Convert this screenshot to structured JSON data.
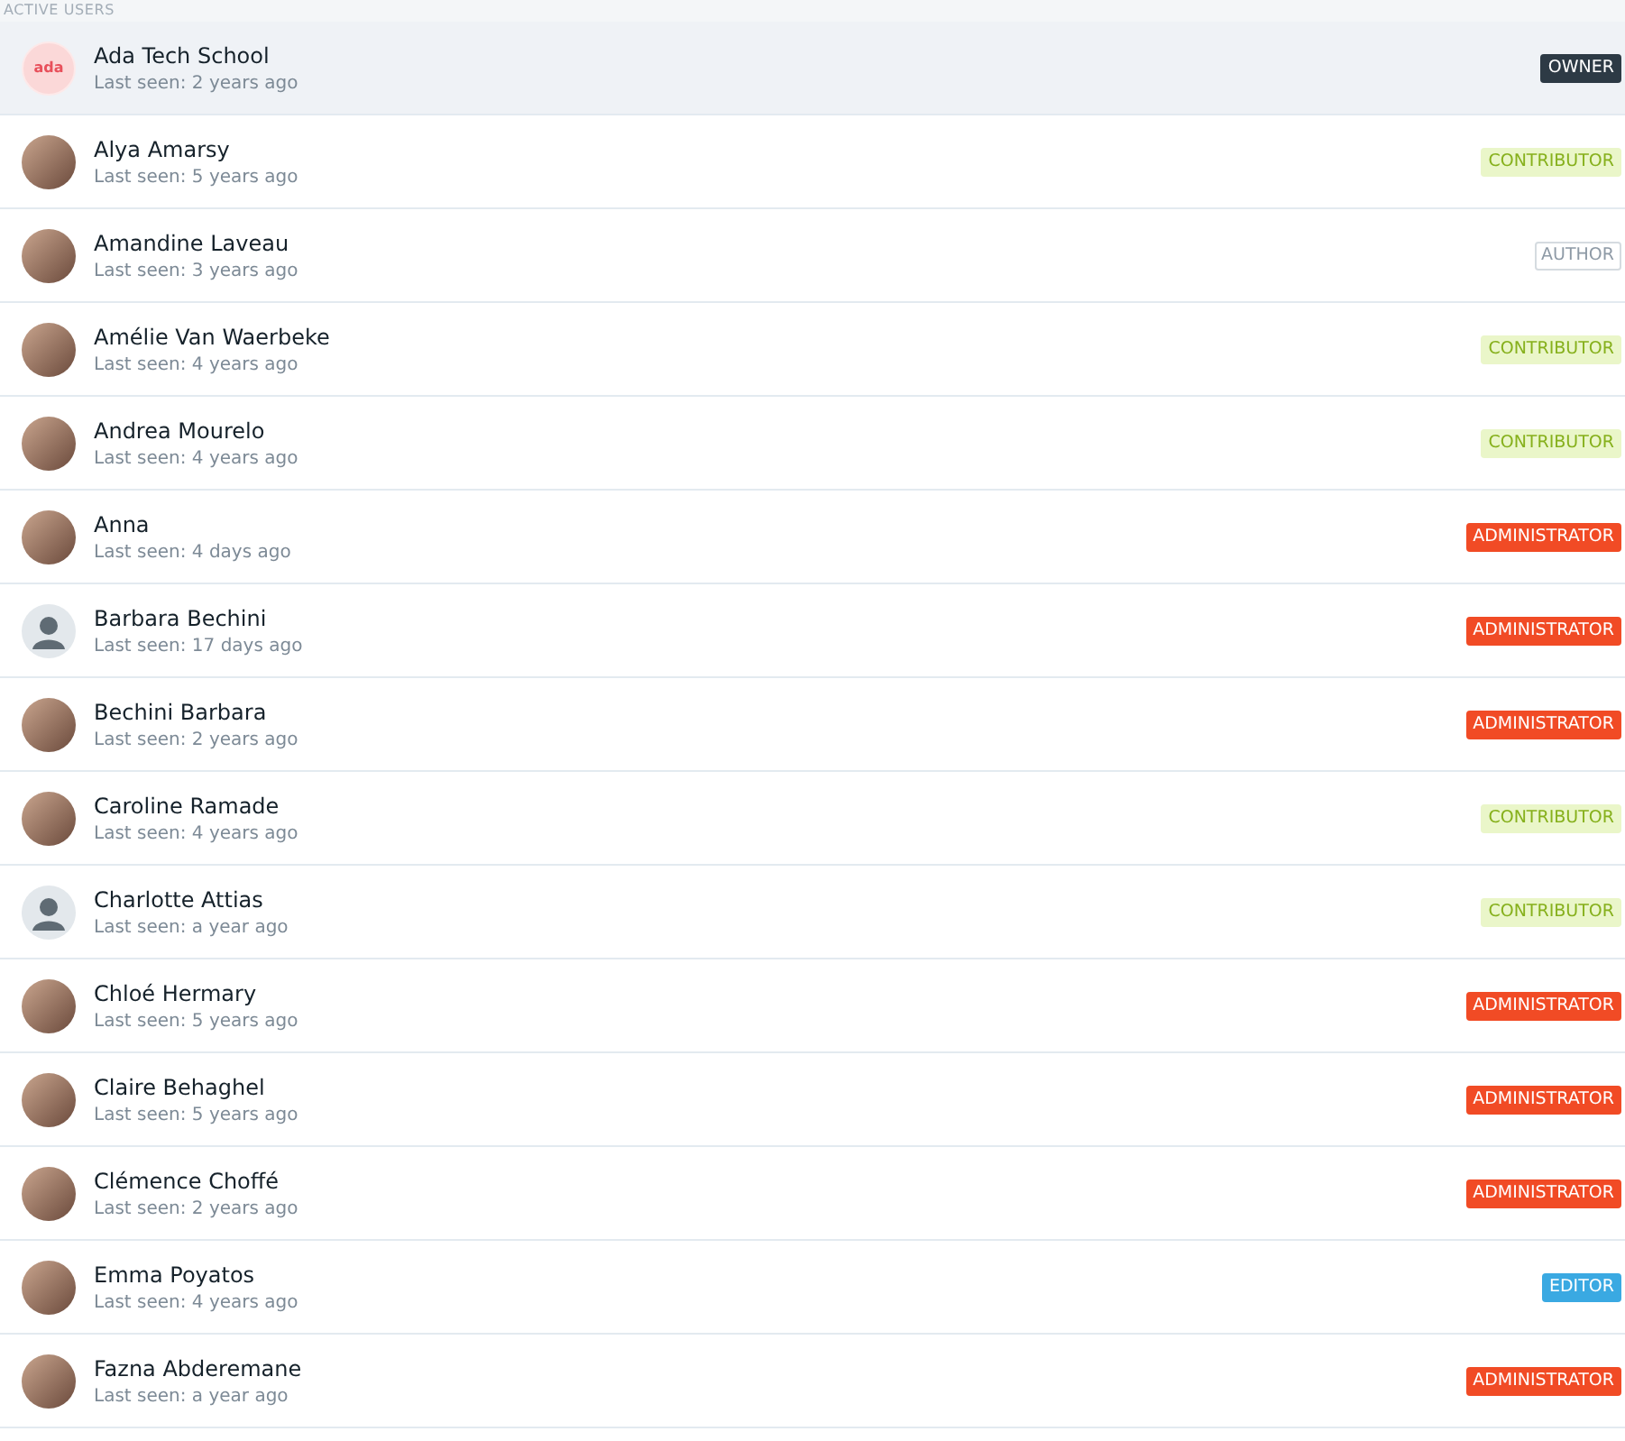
{
  "section_title": "ACTIVE USERS",
  "users": [
    {
      "name": "Ada Tech School",
      "last_seen": "Last seen: 2 years ago",
      "role": {
        "label": "OWNER",
        "kind": "owner"
      },
      "avatar": {
        "kind": "logo",
        "text": "ada"
      },
      "selected": true
    },
    {
      "name": "Alya Amarsy",
      "last_seen": "Last seen: 5 years ago",
      "role": {
        "label": "CONTRIBUTOR",
        "kind": "contributor"
      },
      "avatar": {
        "kind": "photo"
      },
      "selected": false
    },
    {
      "name": "Amandine Laveau",
      "last_seen": "Last seen: 3 years ago",
      "role": {
        "label": "AUTHOR",
        "kind": "author"
      },
      "avatar": {
        "kind": "photo"
      },
      "selected": false
    },
    {
      "name": "Amélie Van Waerbeke",
      "last_seen": "Last seen: 4 years ago",
      "role": {
        "label": "CONTRIBUTOR",
        "kind": "contributor"
      },
      "avatar": {
        "kind": "photo"
      },
      "selected": false
    },
    {
      "name": "Andrea Mourelo",
      "last_seen": "Last seen: 4 years ago",
      "role": {
        "label": "CONTRIBUTOR",
        "kind": "contributor"
      },
      "avatar": {
        "kind": "photo"
      },
      "selected": false
    },
    {
      "name": "Anna",
      "last_seen": "Last seen: 4 days ago",
      "role": {
        "label": "ADMINISTRATOR",
        "kind": "administrator"
      },
      "avatar": {
        "kind": "photo"
      },
      "selected": false
    },
    {
      "name": "Barbara Bechini",
      "last_seen": "Last seen: 17 days ago",
      "role": {
        "label": "ADMINISTRATOR",
        "kind": "administrator"
      },
      "avatar": {
        "kind": "default"
      },
      "selected": false
    },
    {
      "name": "Bechini Barbara",
      "last_seen": "Last seen: 2 years ago",
      "role": {
        "label": "ADMINISTRATOR",
        "kind": "administrator"
      },
      "avatar": {
        "kind": "photo"
      },
      "selected": false
    },
    {
      "name": "Caroline Ramade",
      "last_seen": "Last seen: 4 years ago",
      "role": {
        "label": "CONTRIBUTOR",
        "kind": "contributor"
      },
      "avatar": {
        "kind": "photo"
      },
      "selected": false
    },
    {
      "name": "Charlotte Attias",
      "last_seen": "Last seen: a year ago",
      "role": {
        "label": "CONTRIBUTOR",
        "kind": "contributor"
      },
      "avatar": {
        "kind": "default"
      },
      "selected": false
    },
    {
      "name": "Chloé Hermary",
      "last_seen": "Last seen: 5 years ago",
      "role": {
        "label": "ADMINISTRATOR",
        "kind": "administrator"
      },
      "avatar": {
        "kind": "photo"
      },
      "selected": false
    },
    {
      "name": "Claire Behaghel",
      "last_seen": "Last seen: 5 years ago",
      "role": {
        "label": "ADMINISTRATOR",
        "kind": "administrator"
      },
      "avatar": {
        "kind": "photo"
      },
      "selected": false
    },
    {
      "name": "Clémence Choffé",
      "last_seen": "Last seen: 2 years ago",
      "role": {
        "label": "ADMINISTRATOR",
        "kind": "administrator"
      },
      "avatar": {
        "kind": "photo"
      },
      "selected": false
    },
    {
      "name": "Emma Poyatos",
      "last_seen": "Last seen: 4 years ago",
      "role": {
        "label": "EDITOR",
        "kind": "editor"
      },
      "avatar": {
        "kind": "photo"
      },
      "selected": false
    },
    {
      "name": "Fazna Abderemane",
      "last_seen": "Last seen: a year ago",
      "role": {
        "label": "ADMINISTRATOR",
        "kind": "administrator"
      },
      "avatar": {
        "kind": "photo"
      },
      "selected": false
    }
  ]
}
